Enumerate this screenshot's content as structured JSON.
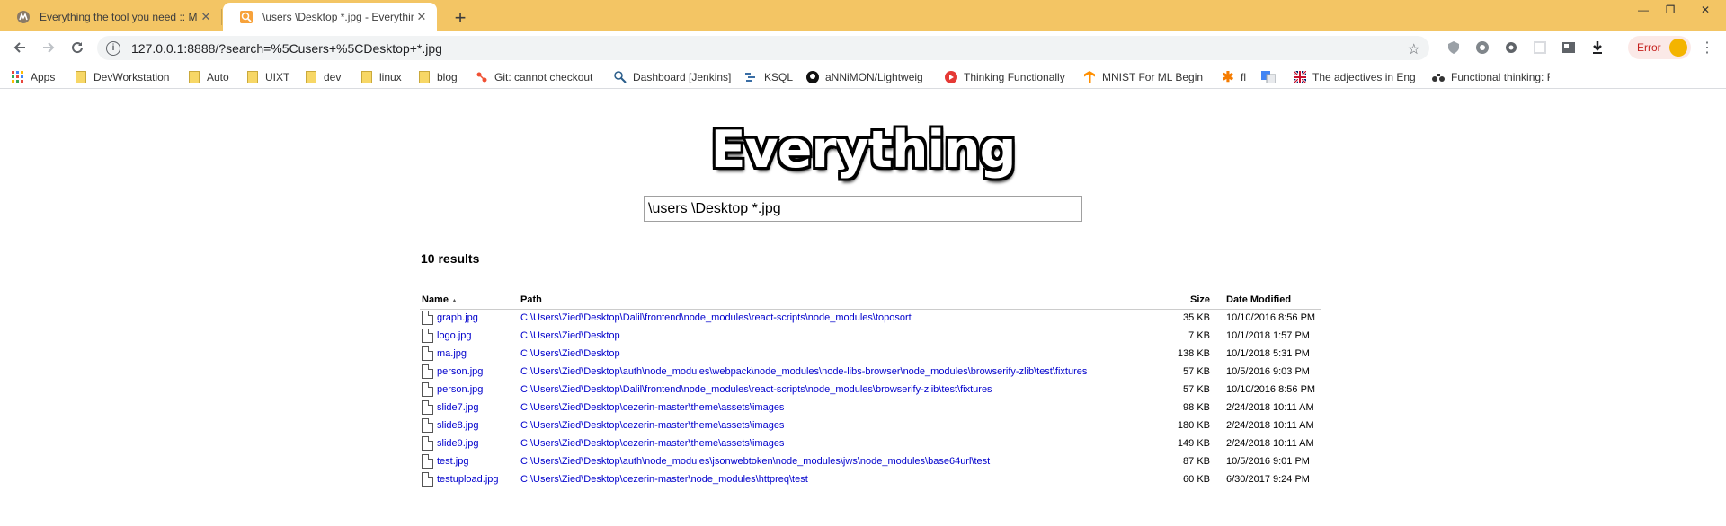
{
  "browser": {
    "tabs": [
      {
        "title": "Everything the tool you need :: M",
        "active": false
      },
      {
        "title": "\\users \\Desktop *.jpg - Everything",
        "active": true
      }
    ],
    "address_bar": {
      "url": "127.0.0.1:8888/?search=%5Cusers+%5CDesktop+*.jpg"
    },
    "error_chip": {
      "label": "Error"
    },
    "bookmarks": [
      {
        "label": "Apps",
        "icon": "apps-grid-icon"
      },
      {
        "label": "DevWorkstation",
        "icon": "folder-icon"
      },
      {
        "label": "Auto",
        "icon": "folder-icon"
      },
      {
        "label": "UIXT",
        "icon": "folder-icon"
      },
      {
        "label": "dev",
        "icon": "folder-icon"
      },
      {
        "label": "linux",
        "icon": "folder-icon"
      },
      {
        "label": "blog",
        "icon": "folder-icon"
      },
      {
        "label": "Git: cannot checkout",
        "icon": "git-icon"
      },
      {
        "label": "Dashboard [Jenkins]",
        "icon": "jenkins-icon"
      },
      {
        "label": "KSQL",
        "icon": "ksql-icon"
      },
      {
        "label": "aNNiMON/Lightweig",
        "icon": "github-icon"
      },
      {
        "label": "Thinking Functionally",
        "icon": "video-icon"
      },
      {
        "label": "MNIST For ML Begin",
        "icon": "tensorflow-icon"
      },
      {
        "label": "fl",
        "icon": "asterisk-icon"
      },
      {
        "label": "",
        "icon": "translate-icon"
      },
      {
        "label": "The adjectives in Eng",
        "icon": "flag-icon"
      },
      {
        "label": "Functional thinking: F",
        "icon": "ibm-icon"
      }
    ]
  },
  "page": {
    "logo_text": "Everything",
    "search": {
      "value": "\\users \\Desktop *.jpg"
    },
    "results_count": "10 results",
    "columns": {
      "name": "Name",
      "path": "Path",
      "size": "Size",
      "date": "Date Modified"
    },
    "rows": [
      {
        "name": "graph.jpg",
        "path": "C:\\Users\\Zied\\Desktop\\Dalil\\frontend\\node_modules\\react-scripts\\node_modules\\toposort",
        "size": "35 KB",
        "date": "10/10/2016 8:56 PM"
      },
      {
        "name": "logo.jpg",
        "path": "C:\\Users\\Zied\\Desktop",
        "size": "7 KB",
        "date": "10/1/2018 1:57 PM"
      },
      {
        "name": "ma.jpg",
        "path": "C:\\Users\\Zied\\Desktop",
        "size": "138 KB",
        "date": "10/1/2018 5:31 PM"
      },
      {
        "name": "person.jpg",
        "path": "C:\\Users\\Zied\\Desktop\\auth\\node_modules\\webpack\\node_modules\\node-libs-browser\\node_modules\\browserify-zlib\\test\\fixtures",
        "size": "57 KB",
        "date": "10/5/2016 9:03 PM"
      },
      {
        "name": "person.jpg",
        "path": "C:\\Users\\Zied\\Desktop\\Dalil\\frontend\\node_modules\\react-scripts\\node_modules\\browserify-zlib\\test\\fixtures",
        "size": "57 KB",
        "date": "10/10/2016 8:56 PM"
      },
      {
        "name": "slide7.jpg",
        "path": "C:\\Users\\Zied\\Desktop\\cezerin-master\\theme\\assets\\images",
        "size": "98 KB",
        "date": "2/24/2018 10:11 AM"
      },
      {
        "name": "slide8.jpg",
        "path": "C:\\Users\\Zied\\Desktop\\cezerin-master\\theme\\assets\\images",
        "size": "180 KB",
        "date": "2/24/2018 10:11 AM"
      },
      {
        "name": "slide9.jpg",
        "path": "C:\\Users\\Zied\\Desktop\\cezerin-master\\theme\\assets\\images",
        "size": "149 KB",
        "date": "2/24/2018 10:11 AM"
      },
      {
        "name": "test.jpg",
        "path": "C:\\Users\\Zied\\Desktop\\auth\\node_modules\\jsonwebtoken\\node_modules\\jws\\node_modules\\base64url\\test",
        "size": "87 KB",
        "date": "10/5/2016 9:01 PM"
      },
      {
        "name": "testupload.jpg",
        "path": "C:\\Users\\Zied\\Desktop\\cezerin-master\\node_modules\\httpreq\\test",
        "size": "60 KB",
        "date": "6/30/2017 9:24 PM"
      }
    ]
  }
}
